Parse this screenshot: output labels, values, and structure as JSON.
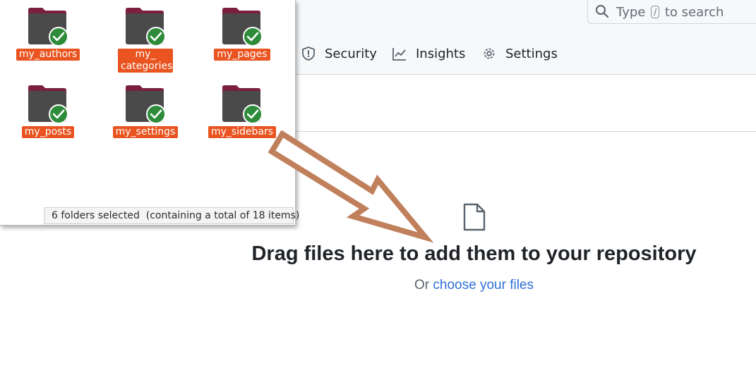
{
  "search": {
    "prefix": "Type",
    "key": "/",
    "suffix": "to search"
  },
  "nav": {
    "security": "Security",
    "insights": "Insights",
    "settings": "Settings"
  },
  "dropzone": {
    "title": "Drag files here to add them to your repository",
    "or": "Or",
    "choose": "choose your files"
  },
  "file_manager": {
    "folders": [
      {
        "label": "my_authors"
      },
      {
        "label": "my_ categories"
      },
      {
        "label": "my_pages"
      },
      {
        "label": "my_posts"
      },
      {
        "label": "my_settings"
      },
      {
        "label": "my_sidebars"
      }
    ],
    "status": "6 folders selected  (containing a total of 18 items)"
  },
  "colors": {
    "accent": "#e95420",
    "check": "#2e8b3a",
    "folder": "#4a4a4a",
    "arrow": "#c0805c",
    "link": "#2f6fd6"
  }
}
